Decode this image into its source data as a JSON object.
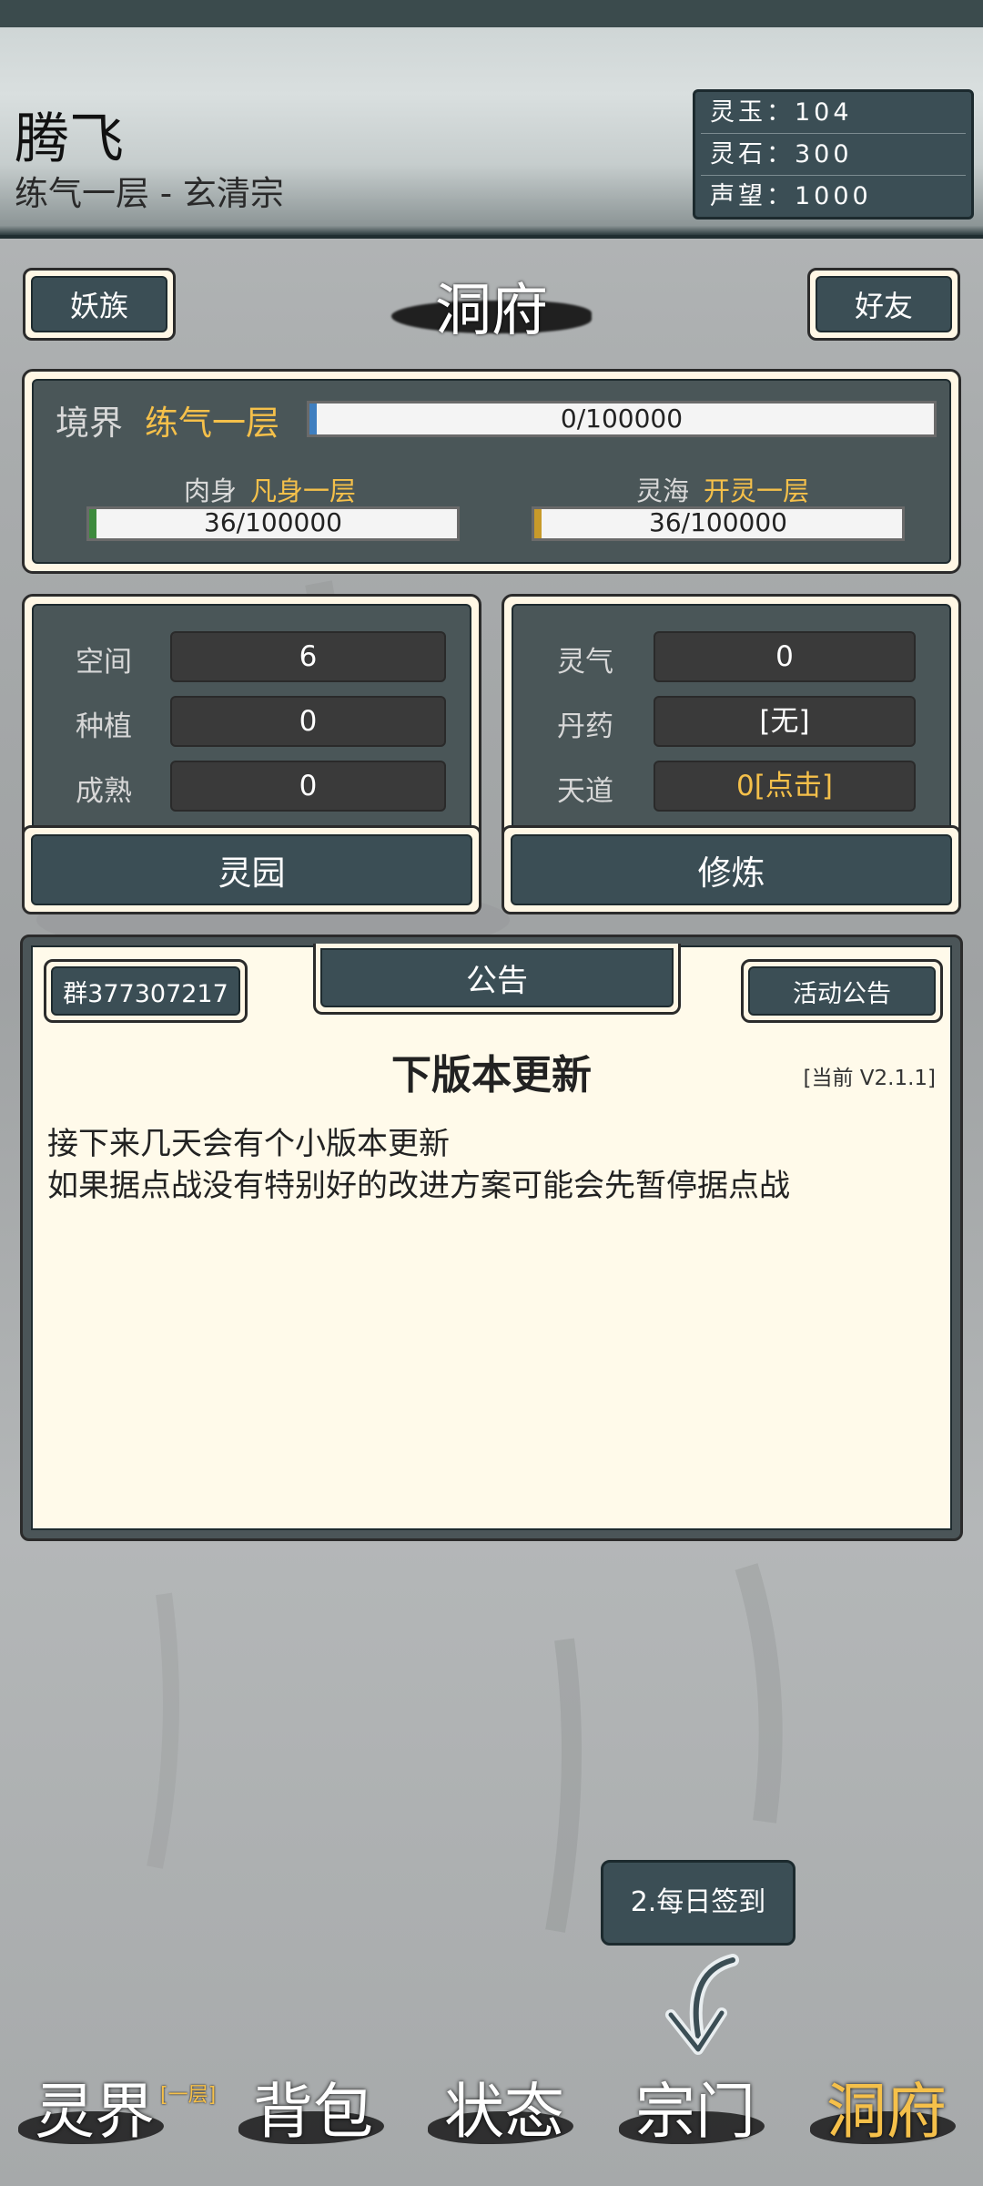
{
  "player": {
    "name": "腾飞",
    "subtitle": "练气一层 - 玄清宗"
  },
  "resources": [
    {
      "label": "灵玉：104"
    },
    {
      "label": "灵石：300"
    },
    {
      "label": "声望：1000"
    }
  ],
  "top_buttons": {
    "left": "妖族",
    "right": "好友"
  },
  "page_title": "洞府",
  "realm": {
    "label": "境界",
    "value": "练气一层",
    "progress_text": "0/100000",
    "body_label": "肉身",
    "body_value": "凡身一层",
    "body_progress_text": "36/100000",
    "sea_label": "灵海",
    "sea_value": "开灵一层",
    "sea_progress_text": "36/100000"
  },
  "garden": {
    "rows": [
      {
        "label": "空间",
        "value": "6"
      },
      {
        "label": "种植",
        "value": "0"
      },
      {
        "label": "成熟",
        "value": "0"
      }
    ],
    "button": "灵园"
  },
  "cultivate": {
    "rows": [
      {
        "label": "灵气",
        "value": "0"
      },
      {
        "label": "丹药",
        "value": "[无]"
      },
      {
        "label": "天道",
        "value": "0[点击]"
      }
    ],
    "button": "修炼"
  },
  "notice": {
    "group_button": "群377307217",
    "tab_label": "公告",
    "activity_button": "活动公告",
    "heading": "下版本更新",
    "version": "[当前 V2.1.1]",
    "lines": [
      "接下来几天会有个小版本更新",
      "如果据点战没有特别好的改进方案可能会先暂停据点战"
    ]
  },
  "tip": {
    "text": "2.每日签到"
  },
  "bottom_nav": [
    {
      "label": "灵界",
      "badge": "[一层]"
    },
    {
      "label": "背包"
    },
    {
      "label": "状态"
    },
    {
      "label": "宗门"
    },
    {
      "label": "洞府"
    }
  ],
  "colors": {
    "accent_gold": "#f5c04a",
    "panel_teal": "#3b4e55",
    "panel_cream": "#fff7e5"
  }
}
